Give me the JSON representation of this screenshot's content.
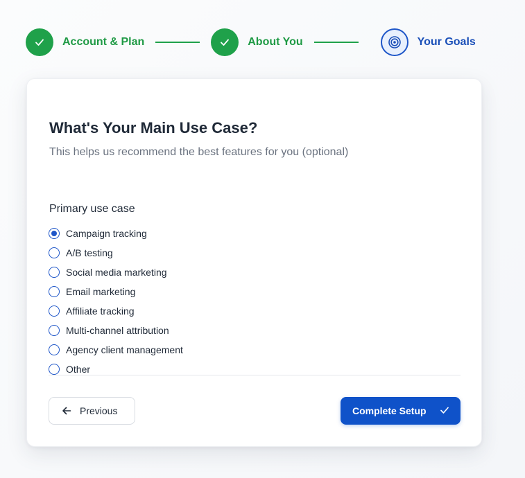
{
  "stepper": {
    "steps": [
      {
        "label": "Account & Plan",
        "state": "completed",
        "icon": "check-icon"
      },
      {
        "label": "About You",
        "state": "completed",
        "icon": "check-icon"
      },
      {
        "label": "Your Goals",
        "state": "current",
        "icon": "target-icon"
      }
    ]
  },
  "card": {
    "title": "What's Your Main Use Case?",
    "subtitle": "This helps us recommend the best features for you (optional)",
    "group_label": "Primary use case",
    "options": [
      {
        "label": "Campaign tracking",
        "selected": true
      },
      {
        "label": "A/B testing",
        "selected": false
      },
      {
        "label": "Social media marketing",
        "selected": false
      },
      {
        "label": "Email marketing",
        "selected": false
      },
      {
        "label": "Affiliate tracking",
        "selected": false
      },
      {
        "label": "Multi-channel attribution",
        "selected": false
      },
      {
        "label": "Agency client management",
        "selected": false
      },
      {
        "label": "Other",
        "selected": false
      }
    ]
  },
  "footer": {
    "previous_label": "Previous",
    "previous_icon": "arrow-left-icon",
    "complete_label": "Complete Setup",
    "complete_icon": "check-icon"
  },
  "colors": {
    "success": "#1fa14a",
    "primary": "#0f52c9",
    "text": "#1f2937",
    "muted": "#6b7380"
  }
}
